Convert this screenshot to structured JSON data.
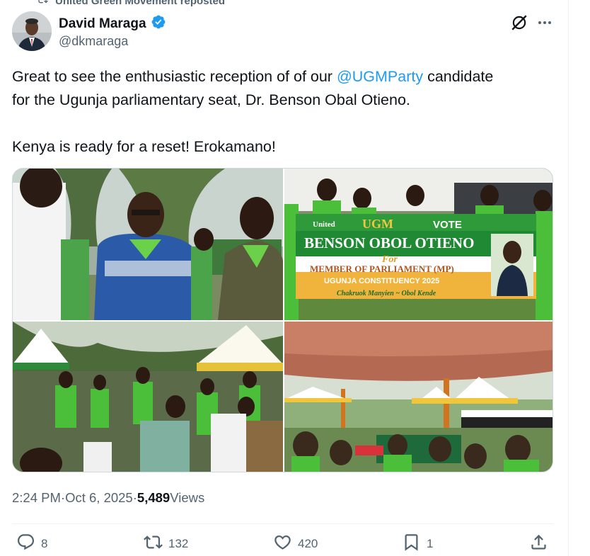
{
  "repost": {
    "label": "United Green Movement reposted",
    "icon": "repost-icon"
  },
  "author": {
    "display_name": "David Maraga",
    "handle": "@dkmaraga",
    "verified": true,
    "verified_color": "#1d9bf0"
  },
  "tweet": {
    "line1_pre": "Great to see the enthusiastic reception of of our ",
    "mention": "@UGMParty",
    "line1_post": " candidate",
    "line2": "for the Ugunja parliamentary seat, Dr. Benson Obal Otieno.",
    "line3": "Kenya is ready for a reset!  Erokamano!"
  },
  "banner": {
    "party_small": "United",
    "party": "UGM",
    "vote": "VOTE",
    "candidate": "BENSON OBOL OTIENO",
    "for": "For",
    "office": "MEMBER OF PARLIAMENT (MP)",
    "constituency": "UGUNJA CONSTITUENCY 2025",
    "slogan": "Chakruok Manyien ~ Obol Kende"
  },
  "meta": {
    "time": "2:24 PM",
    "sep1": " · ",
    "date": "Oct 6, 2025",
    "sep2": " · ",
    "views_count": "5,489",
    "views_label": " Views"
  },
  "actions": {
    "replies": "8",
    "reposts": "132",
    "likes": "420",
    "bookmarks": "1"
  },
  "colors": {
    "text": "#0f1419",
    "secondary": "#536471",
    "accent": "#1d9bf0",
    "party_green": "#5ec43a"
  }
}
